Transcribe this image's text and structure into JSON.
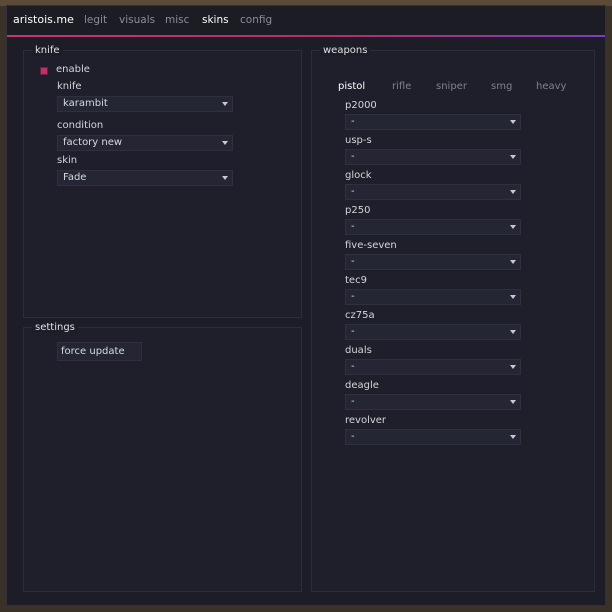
{
  "app": {
    "brand": "aristois.me"
  },
  "nav": [
    {
      "label": "legit"
    },
    {
      "label": "visuals"
    },
    {
      "label": "misc"
    },
    {
      "label": "skins"
    },
    {
      "label": "config"
    }
  ],
  "knife_panel": {
    "title": "knife",
    "enable_label": "enable",
    "knife_label": "knife",
    "knife_value": "karambit",
    "condition_label": "condition",
    "condition_value": "factory new",
    "skin_label": "skin",
    "skin_value": "Fade"
  },
  "settings_panel": {
    "title": "settings",
    "force_update_label": "force update"
  },
  "weapons_panel": {
    "title": "weapons",
    "tabs": [
      {
        "label": "pistol"
      },
      {
        "label": "rifle"
      },
      {
        "label": "sniper"
      },
      {
        "label": "smg"
      },
      {
        "label": "heavy"
      }
    ],
    "weapons": [
      {
        "name": "p2000",
        "value": "-"
      },
      {
        "name": "usp-s",
        "value": "-"
      },
      {
        "name": "glock",
        "value": "-"
      },
      {
        "name": "p250",
        "value": "-"
      },
      {
        "name": "five-seven",
        "value": "-"
      },
      {
        "name": "tec9",
        "value": "-"
      },
      {
        "name": "cz75a",
        "value": "-"
      },
      {
        "name": "duals",
        "value": "-"
      },
      {
        "name": "deagle",
        "value": "-"
      },
      {
        "name": "revolver",
        "value": "-"
      }
    ]
  },
  "colors": {
    "accent_pink": "#c9356d",
    "accent_purple": "#7e3cbf",
    "window_bg": "#1c1d26"
  }
}
